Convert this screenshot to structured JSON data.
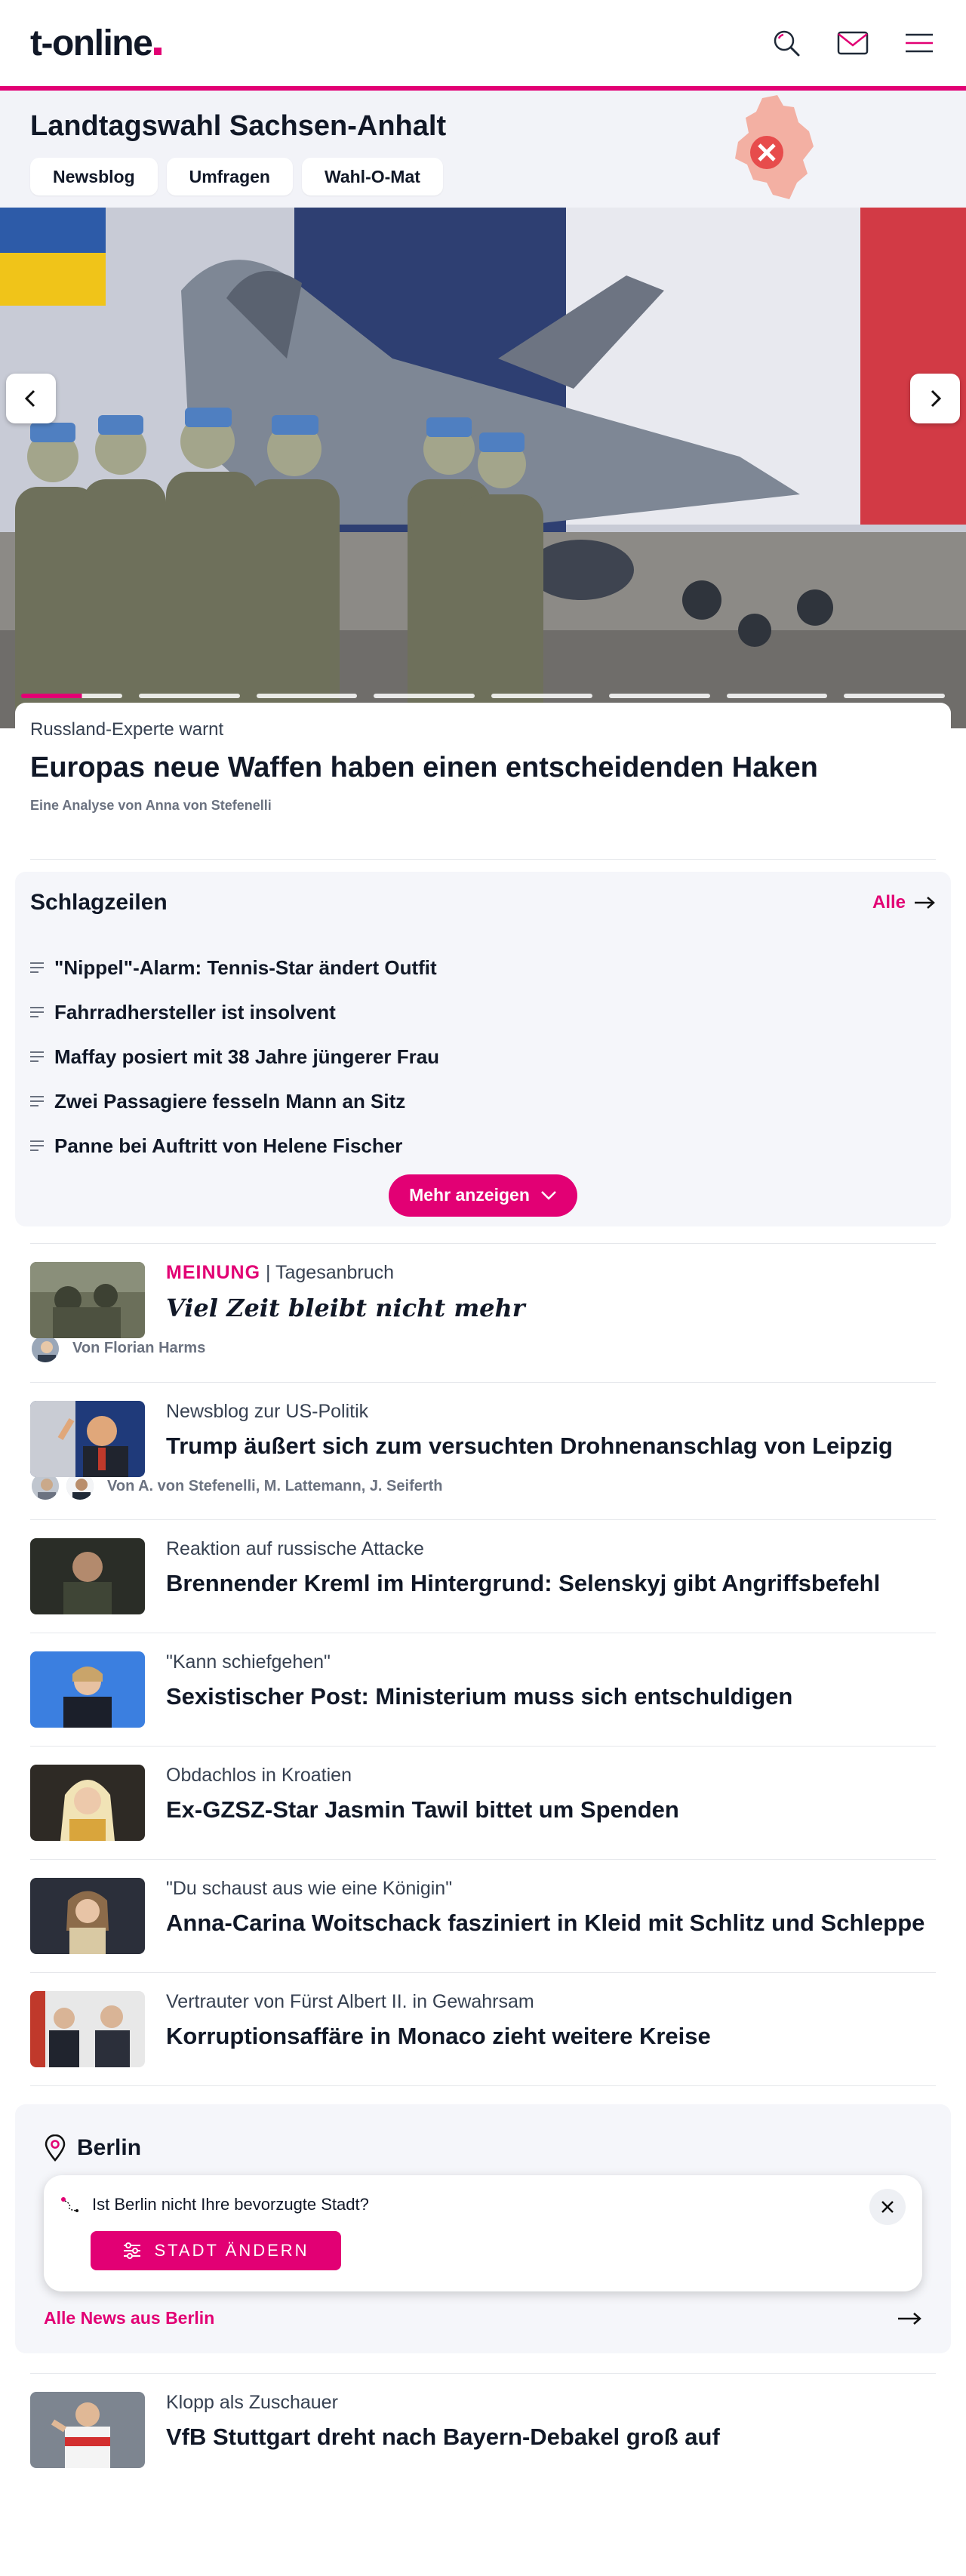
{
  "header": {
    "logo_text": "t-online",
    "brand_color": "#e20074",
    "icons": [
      "search-icon",
      "mail-icon",
      "menu-icon"
    ]
  },
  "election": {
    "title": "Landtagswahl Sachsen-Anhalt",
    "pills": [
      "Newsblog",
      "Umfragen",
      "Wahl-O-Mat"
    ]
  },
  "hero": {
    "kicker": "Russland-Experte warnt",
    "headline": "Europas neue Waffen haben einen entscheidenden Haken",
    "byline": "Eine Analyse von Anna von Stefenelli",
    "slides_total": 8,
    "active_slide": 1
  },
  "headlines": {
    "title": "Schlagzeilen",
    "all_label": "Alle",
    "items": [
      "\"Nippel\"-Alarm: Tennis-Star ändert Outfit",
      "Fahrradhersteller ist insolvent",
      "Maffay posiert mit 38 Jahre jüngerer Frau",
      "Zwei Passagiere fesseln Mann an Sitz",
      "Panne bei Auftritt von Helene Fischer"
    ],
    "more_label": "Mehr anzeigen"
  },
  "articles": [
    {
      "opinion_label": "MEINUNG",
      "kicker": " | Tagesanbruch",
      "title": "Viel Zeit bleibt nicht mehr",
      "author": "Von Florian Harms"
    },
    {
      "kicker": "Newsblog zur US-Politik",
      "title": "Trump äußert sich zum versuchten Drohnenanschlag von Leipzig",
      "author": "Von A. von Stefenelli, M. Lattemann, J. Seiferth"
    },
    {
      "kicker": "Reaktion auf russische Attacke",
      "title": "Brennender Kreml im Hintergrund: Selenskyj gibt Angriffsbefehl"
    },
    {
      "kicker": "\"Kann schiefgehen\"",
      "title": "Sexistischer Post: Ministerium muss sich entschuldigen"
    },
    {
      "kicker": "Obdachlos in Kroatien",
      "title": "Ex-GZSZ-Star Jasmin Tawil bittet um Spenden"
    },
    {
      "kicker": "\"Du schaust aus wie eine Königin\"",
      "title": "Anna-Carina Woitschack fasziniert in Kleid mit Schlitz und Schleppe"
    },
    {
      "kicker": "Vertrauter von Fürst Albert II. in Gewahrsam",
      "title": "Korruptionsaffäre in Monaco zieht weitere Kreise"
    }
  ],
  "berlin": {
    "title": "Berlin",
    "question": "Ist Berlin nicht Ihre bevorzugte Stadt?",
    "change_label": "STADT ÄNDERN",
    "all_news_label": "Alle News aus Berlin"
  },
  "bottom_article": {
    "kicker": "Klopp als Zuschauer",
    "title": "VfB Stuttgart dreht nach Bayern-Debakel groß auf"
  }
}
